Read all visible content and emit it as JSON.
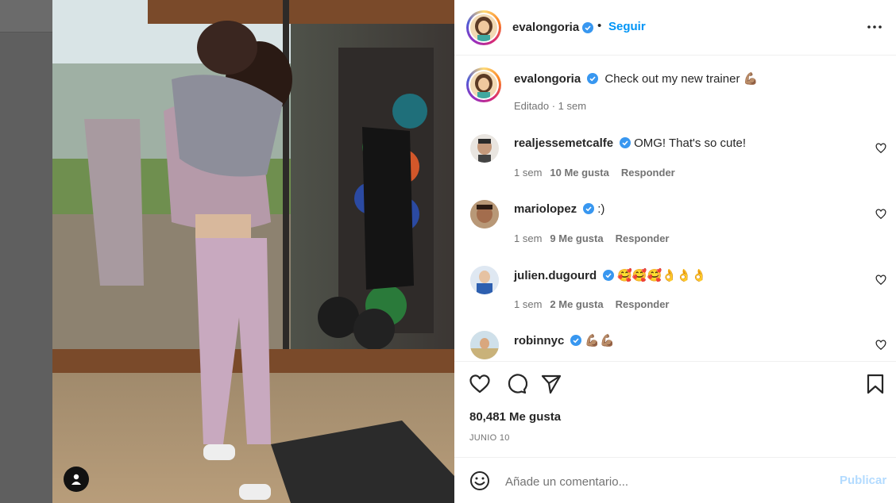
{
  "post": {
    "author": "evalongoria",
    "follow_label": "Seguir",
    "separator": "•",
    "caption_author": "evalongoria",
    "caption_text": "Check out my new trainer",
    "caption_emoji": "💪🏽",
    "caption_meta": "Editado · 1 sem"
  },
  "comments": [
    {
      "user": "realjessemetcalfe",
      "text": "OMG! That's so cute!",
      "time": "1 sem",
      "likes": "10 Me gusta",
      "reply": "Responder"
    },
    {
      "user": "mariolopez",
      "text": ":)",
      "time": "1 sem",
      "likes": "9 Me gusta",
      "reply": "Responder"
    },
    {
      "user": "julien.dugourd",
      "text": "🥰🥰🥰👌👌👌",
      "time": "1 sem",
      "likes": "2 Me gusta",
      "reply": "Responder"
    },
    {
      "user": "robinnyc",
      "text": "💪🏽💪🏽",
      "time": "",
      "likes": "",
      "reply": ""
    }
  ],
  "footer": {
    "likes_count": "80,481 Me gusta",
    "date": "JUNIO 10",
    "comment_placeholder": "Añade un comentario...",
    "publish_label": "Publicar"
  },
  "icons": {
    "verified": "verified-badge-icon",
    "more": "more-options-icon",
    "like": "heart-icon",
    "comment": "comment-icon",
    "share": "share-icon",
    "save": "bookmark-icon",
    "emoji": "emoji-icon",
    "user_tag": "user-tag-icon"
  },
  "colors": {
    "link": "#0095f6",
    "verified": "#3897f0",
    "publish_disabled": "#b3dbff",
    "text": "#262626",
    "secondary": "#737373"
  }
}
